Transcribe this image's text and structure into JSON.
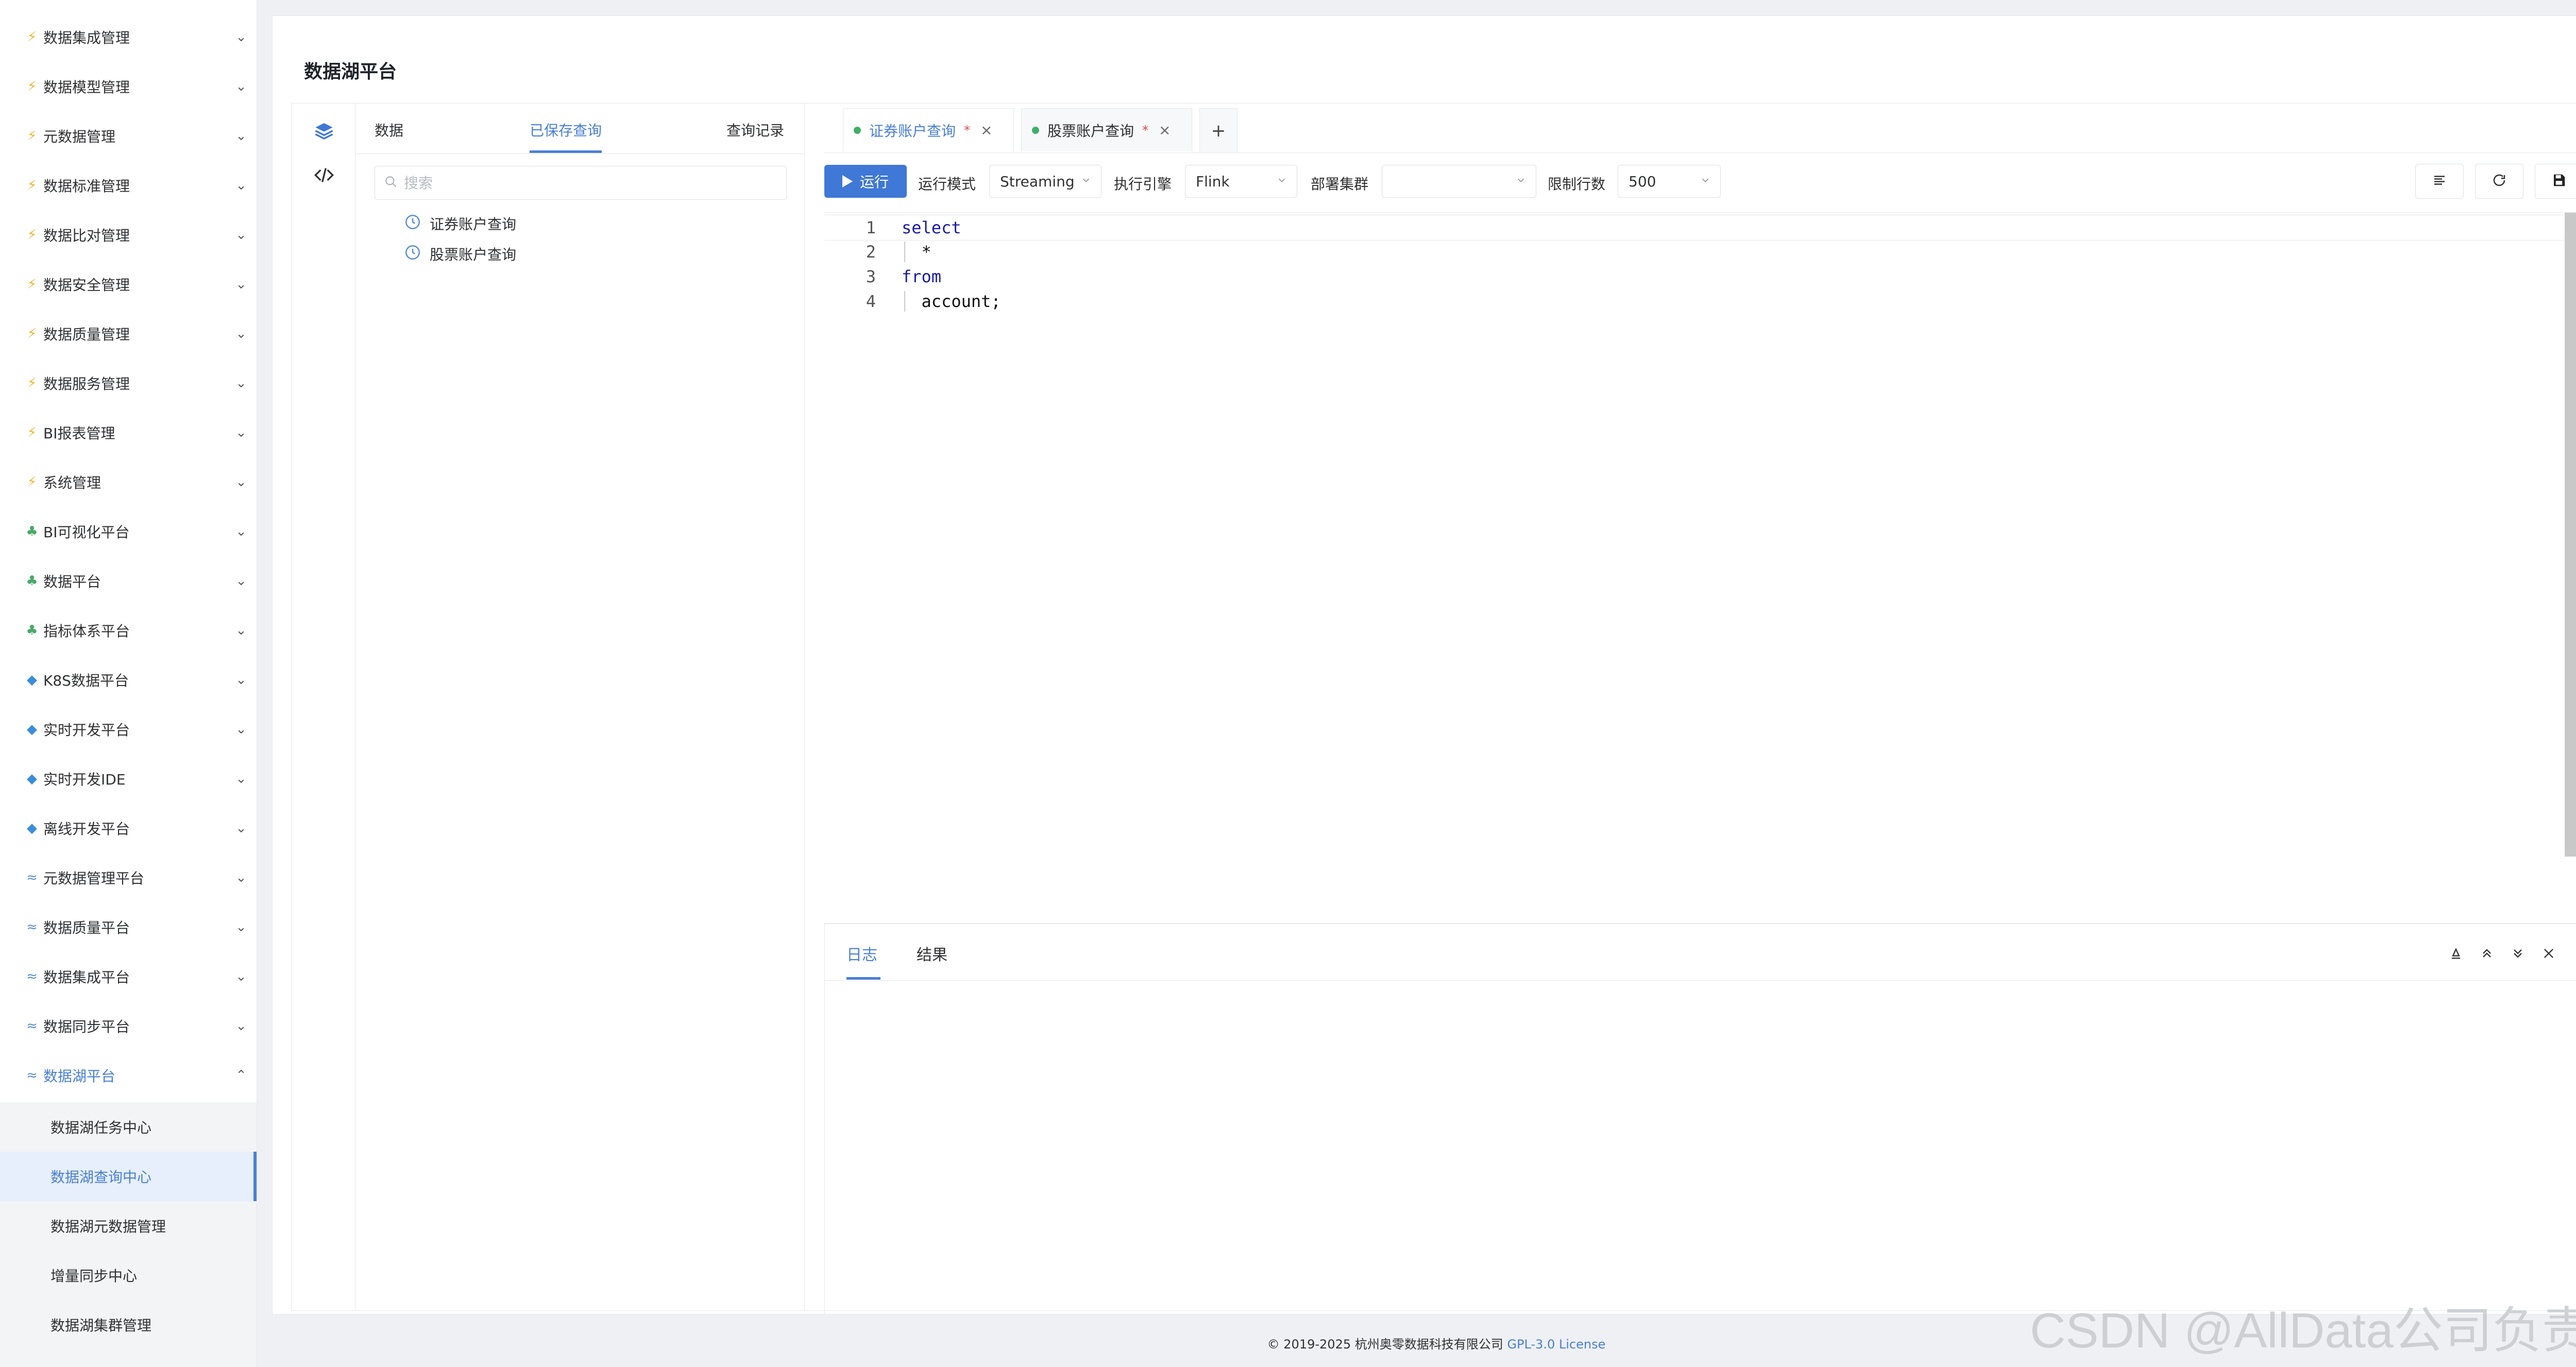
{
  "sidebar": {
    "items": [
      {
        "label": "数据集成管理",
        "icon": "bolt-icon"
      },
      {
        "label": "数据模型管理",
        "icon": "bolt-icon"
      },
      {
        "label": "元数据管理",
        "icon": "bolt-icon"
      },
      {
        "label": "数据标准管理",
        "icon": "bolt-icon"
      },
      {
        "label": "数据比对管理",
        "icon": "bolt-icon"
      },
      {
        "label": "数据安全管理",
        "icon": "bolt-icon"
      },
      {
        "label": "数据质量管理",
        "icon": "bolt-icon"
      },
      {
        "label": "数据服务管理",
        "icon": "bolt-icon"
      },
      {
        "label": "BI报表管理",
        "icon": "bolt-icon"
      },
      {
        "label": "系统管理",
        "icon": "bolt-icon"
      },
      {
        "label": "BI可视化平台",
        "icon": "tree-icon"
      },
      {
        "label": "数据平台",
        "icon": "tree-icon"
      },
      {
        "label": "指标体系平台",
        "icon": "tree-icon"
      },
      {
        "label": "K8S数据平台",
        "icon": "gem-icon"
      },
      {
        "label": "实时开发平台",
        "icon": "gem-icon"
      },
      {
        "label": "实时开发IDE",
        "icon": "gem-icon"
      },
      {
        "label": "离线开发平台",
        "icon": "gem-icon"
      },
      {
        "label": "元数据管理平台",
        "icon": "waves-icon"
      },
      {
        "label": "数据质量平台",
        "icon": "waves-icon"
      },
      {
        "label": "数据集成平台",
        "icon": "waves-icon"
      },
      {
        "label": "数据同步平台",
        "icon": "waves-icon"
      },
      {
        "label": "数据湖平台",
        "icon": "waves-icon"
      }
    ],
    "submenu": [
      {
        "label": "数据湖任务中心"
      },
      {
        "label": "数据湖查询中心"
      },
      {
        "label": "数据湖元数据管理"
      },
      {
        "label": "增量同步中心"
      },
      {
        "label": "数据湖集群管理"
      }
    ]
  },
  "page": {
    "title": "数据湖平台"
  },
  "left_panel": {
    "tabs": [
      "数据",
      "已保存查询",
      "查询记录"
    ],
    "active_tab": "已保存查询",
    "search_placeholder": "搜索",
    "saved_queries": [
      "证券账户查询",
      "股票账户查询"
    ]
  },
  "query_tabs": [
    {
      "label": "证券账户查询",
      "modified_mark": "*",
      "active": true
    },
    {
      "label": "股票账户查询",
      "modified_mark": "*",
      "active": false
    }
  ],
  "add_tab_label": "+",
  "toolbar": {
    "run_label": "运行",
    "run_mode_label": "运行模式",
    "run_mode_value": "Streaming",
    "engine_label": "执行引擎",
    "engine_value": "Flink",
    "cluster_label": "部署集群",
    "cluster_value": "",
    "limit_label": "限制行数",
    "limit_value": "500"
  },
  "editor": {
    "lines": [
      {
        "num": "1",
        "text": "select"
      },
      {
        "num": "2",
        "text": "  *"
      },
      {
        "num": "3",
        "text": "from"
      },
      {
        "num": "4",
        "text": "  account;"
      }
    ]
  },
  "result_panel": {
    "tabs": [
      "日志",
      "结果"
    ],
    "active_tab": "日志"
  },
  "footer": {
    "copyright": "© 2019-2025 杭州奥零数据科技有限公司",
    "license": "GPL-3.0 License"
  },
  "watermark": "CSDN @AllData公司负责人",
  "colors": {
    "accent": "#4a7fd6",
    "run_button": "#3f78d6",
    "tab_dot": "#3fae67",
    "modified_star": "#e0464c"
  }
}
